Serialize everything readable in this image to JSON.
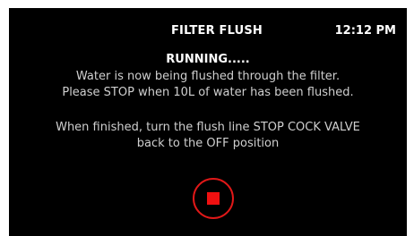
{
  "header": {
    "title": "FILTER FLUSH",
    "time": "12:12 PM"
  },
  "main": {
    "status": "RUNNING.....",
    "line1": "Water is now being flushed through the filter.",
    "line2": "Please STOP when 10L of water has been flushed.",
    "line3": "When finished, turn the flush line STOP COCK VALVE",
    "line4": "back to the OFF position"
  },
  "controls": {
    "stop_icon": "stop-icon",
    "stop_color": "#f01010",
    "ring_color": "#e01818"
  }
}
